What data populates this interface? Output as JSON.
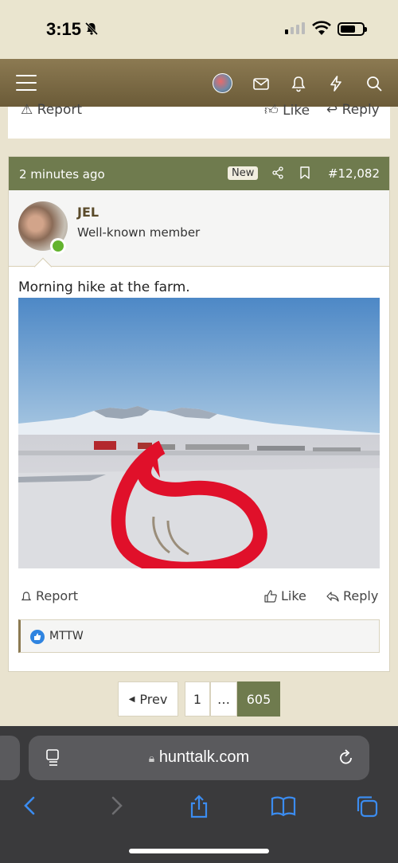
{
  "status_bar": {
    "time": "3:15"
  },
  "header": {
    "menu_label": "",
    "icons": [
      "avatar",
      "mail-icon",
      "bell-icon",
      "bolt-icon",
      "search-icon"
    ]
  },
  "previous_post": {
    "report": "Report",
    "like": "Like",
    "reply": "Reply"
  },
  "post": {
    "time": "2 minutes ago",
    "badge": "New",
    "number": "#12,082",
    "user": {
      "name": "JEL",
      "title": "Well-known member"
    },
    "text": "Morning hike at the farm.",
    "actions": {
      "report": "Report",
      "like": "Like",
      "reply": "Reply"
    },
    "reactions": {
      "users": "MTTW"
    }
  },
  "pagination": {
    "prev": "Prev",
    "pages": [
      "1",
      "…",
      "605"
    ],
    "current": "605"
  },
  "browser": {
    "url": "hunttalk.com"
  },
  "colors": {
    "header": "#7a6a45",
    "post_header": "#6f7b4e",
    "accent_red": "#e0102a",
    "like_blue": "#2f84e0"
  }
}
